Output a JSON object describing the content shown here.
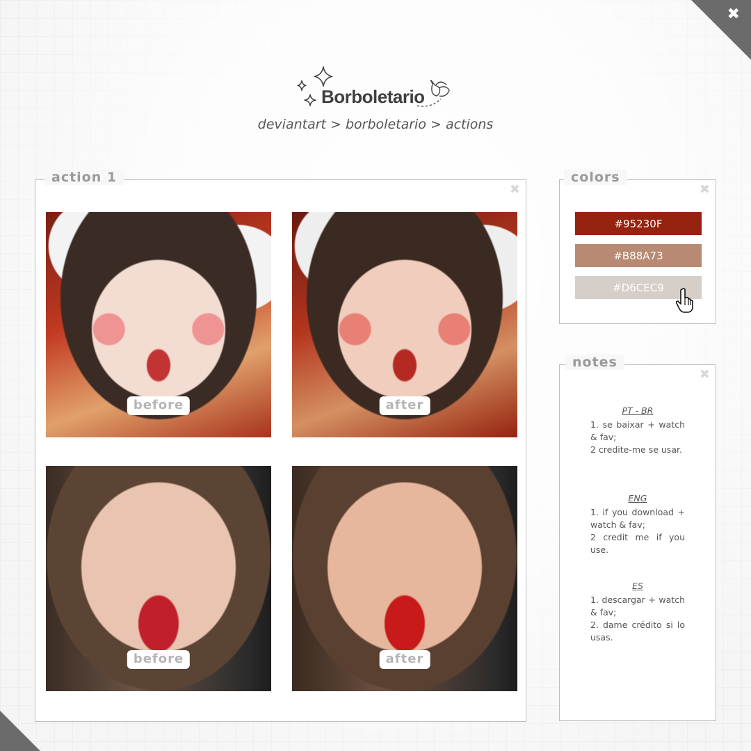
{
  "header": {
    "logo_text": "Borboletario",
    "breadcrumb": "deviantart > borboletario > actions"
  },
  "window": {
    "close_label": "✖"
  },
  "action_panel": {
    "title": "action 1",
    "close_label": "✖",
    "photos": [
      {
        "label": "before"
      },
      {
        "label": "after"
      },
      {
        "label": "before"
      },
      {
        "label": "after"
      }
    ]
  },
  "colors_panel": {
    "title": "colors",
    "close_label": "✖",
    "swatches": [
      {
        "label": "#95230F",
        "color": "#95230F"
      },
      {
        "label": "#B88A73",
        "color": "#B88A73"
      },
      {
        "label": "#D6CEC9",
        "color": "#D6CEC9"
      }
    ]
  },
  "notes_panel": {
    "title": "notes",
    "close_label": "✖",
    "sections": [
      {
        "heading": "PT - BR",
        "lines": [
          "1. se baixar + watch & fav;",
          "2 credite-me se usar."
        ]
      },
      {
        "heading": "ENG",
        "lines": [
          "1. if you download + watch & fav;",
          "2 credit me if you use."
        ]
      },
      {
        "heading": "ES",
        "lines": [
          "1. descargar + watch & fav;",
          "2. dame crédito si lo usas."
        ]
      }
    ]
  },
  "icons": {
    "sparkle": "sparkle-icon",
    "butterfly": "butterfly-icon",
    "cursor": "hand-cursor-icon"
  }
}
